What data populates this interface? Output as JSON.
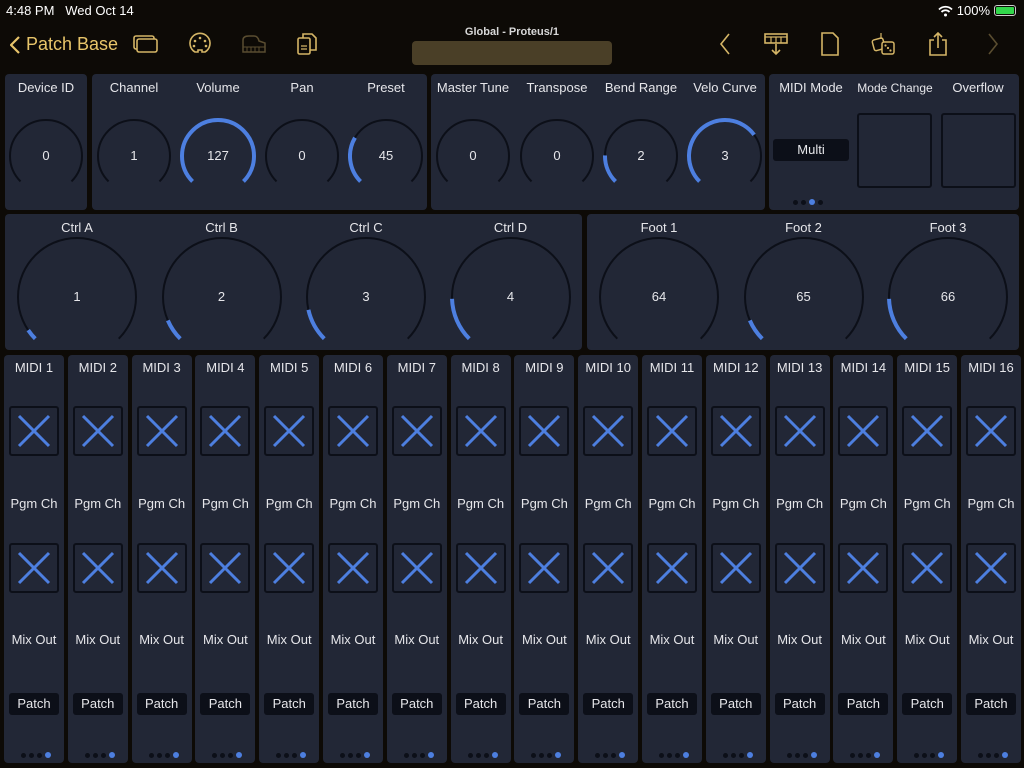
{
  "status_bar": {
    "time": "4:48 PM",
    "date": "Wed Oct 14",
    "battery": "100%",
    "icons": [
      "wifi-icon",
      "battery-charging-icon"
    ]
  },
  "nav": {
    "back_label": "Patch Base",
    "title": "Global - Proteus/1",
    "left_icons": [
      "windows-icon",
      "midi-port-icon",
      "keyboard-icon",
      "copy-icon"
    ],
    "right_icons": [
      "chevron-left-icon",
      "send-to-device-icon",
      "new-document-icon",
      "randomize-dice-icon",
      "share-icon",
      "chevron-right-icon"
    ]
  },
  "colors": {
    "accent": "#4d7fe0",
    "nav_accent": "#e8c56a",
    "panel": "#222736",
    "background": "#0d0a06"
  },
  "row1": {
    "device": {
      "label": "Device ID",
      "value": "0",
      "fraction": 0
    },
    "group1": [
      {
        "label": "Channel",
        "value": "1",
        "fraction": 0
      },
      {
        "label": "Volume",
        "value": "127",
        "fraction": 1.0
      },
      {
        "label": "Pan",
        "value": "0",
        "fraction": 0
      },
      {
        "label": "Preset",
        "value": "45",
        "fraction": 0.28
      }
    ],
    "group2": [
      {
        "label": "Master Tune",
        "value": "0",
        "fraction": 0
      },
      {
        "label": "Transpose",
        "value": "0",
        "fraction": 0
      },
      {
        "label": "Bend Range",
        "value": "2",
        "fraction": 0.17
      },
      {
        "label": "Velo Curve",
        "value": "3",
        "fraction": 0.7
      }
    ],
    "mode": {
      "midi_mode_label": "MIDI Mode",
      "midi_mode_value": "Multi",
      "mode_change_label": "Mode Change",
      "overflow_label": "Overflow",
      "page_index": 2,
      "page_count": 4
    }
  },
  "row2": {
    "ctrl": [
      {
        "label": "Ctrl A",
        "value": "1",
        "fraction": 0.04
      },
      {
        "label": "Ctrl B",
        "value": "2",
        "fraction": 0.08
      },
      {
        "label": "Ctrl C",
        "value": "3",
        "fraction": 0.12
      },
      {
        "label": "Ctrl D",
        "value": "4",
        "fraction": 0.16
      }
    ],
    "foot": [
      {
        "label": "Foot 1",
        "value": "64",
        "fraction": 0
      },
      {
        "label": "Foot 2",
        "value": "65",
        "fraction": 0.08
      },
      {
        "label": "Foot 3",
        "value": "66",
        "fraction": 0.16
      }
    ]
  },
  "strips": {
    "pgm_label": "Pgm Ch",
    "mix_label": "Mix Out",
    "patch_label": "Patch",
    "page_index": 3,
    "page_count": 4,
    "names": [
      "MIDI 1",
      "MIDI 2",
      "MIDI 3",
      "MIDI 4",
      "MIDI 5",
      "MIDI 6",
      "MIDI 7",
      "MIDI 8",
      "MIDI 9",
      "MIDI 10",
      "MIDI 11",
      "MIDI 12",
      "MIDI 13",
      "MIDI 14",
      "MIDI 15",
      "MIDI 16"
    ]
  }
}
